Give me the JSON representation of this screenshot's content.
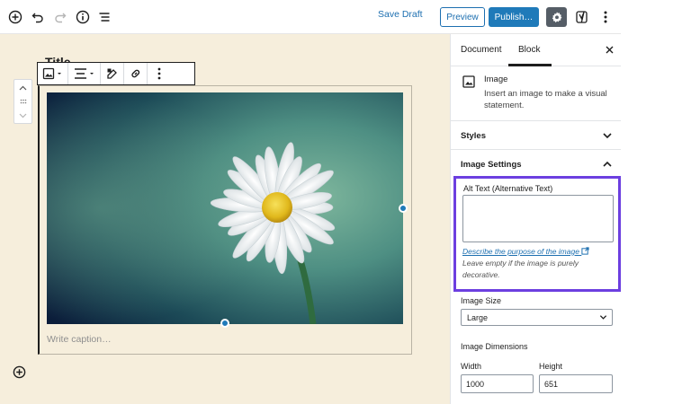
{
  "toolbar": {
    "save_draft": "Save Draft",
    "preview": "Preview",
    "publish": "Publish…"
  },
  "editor": {
    "caption_placeholder": "Write caption…",
    "title_peek": "Title …"
  },
  "sidebar": {
    "tabs": [
      {
        "label": "Document",
        "active": false
      },
      {
        "label": "Block",
        "active": true
      }
    ],
    "block": {
      "icon": "image-icon",
      "title": "Image",
      "description": "Insert an image to make a visual statement."
    },
    "styles_panel": {
      "title": "Styles",
      "expanded": false
    },
    "image_settings_panel": {
      "title": "Image Settings",
      "expanded": true
    },
    "alt_text": {
      "label": "Alt Text (Alternative Text)",
      "value": "",
      "link": "Describe the purpose of the image",
      "help": "Leave empty if the image is purely decorative."
    },
    "image_size": {
      "label": "Image Size",
      "selected": "Large"
    },
    "image_dimensions": {
      "label": "Image Dimensions",
      "width_label": "Width",
      "width_value": "1000",
      "height_label": "Height",
      "height_value": "651"
    }
  },
  "colors": {
    "accent": "#1f7ab9",
    "highlight": "#6c3fe0",
    "canvas": "#f6eedc"
  }
}
